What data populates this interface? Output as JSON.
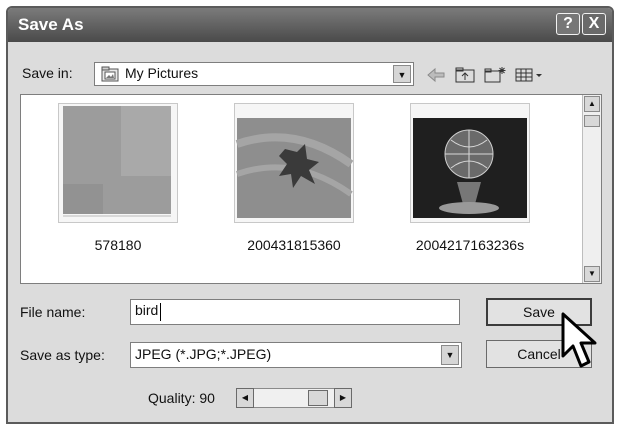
{
  "dialog": {
    "title": "Save As",
    "help_label": "?",
    "close_label": "X"
  },
  "save_in": {
    "label": "Save in:",
    "value": "My Pictures",
    "icon": "folder-pictures-icon"
  },
  "toolbar": {
    "back_icon": "back-arrow-icon",
    "up_icon": "up-folder-icon",
    "new_folder_icon": "new-folder-icon",
    "views_icon": "views-menu-icon"
  },
  "files": [
    {
      "name": "578180",
      "thumb": "gray-texture"
    },
    {
      "name": "200431815360",
      "thumb": "frog-silhouette"
    },
    {
      "name": "2004217163236s",
      "thumb": "glass-globe"
    }
  ],
  "file_name": {
    "label": "File name:",
    "value": "bird"
  },
  "save_as_type": {
    "label": "Save as type:",
    "value": "JPEG (*.JPG;*.JPEG)"
  },
  "quality": {
    "label": "Quality: 90",
    "value": 90
  },
  "buttons": {
    "save": "Save",
    "cancel": "Cancel"
  }
}
